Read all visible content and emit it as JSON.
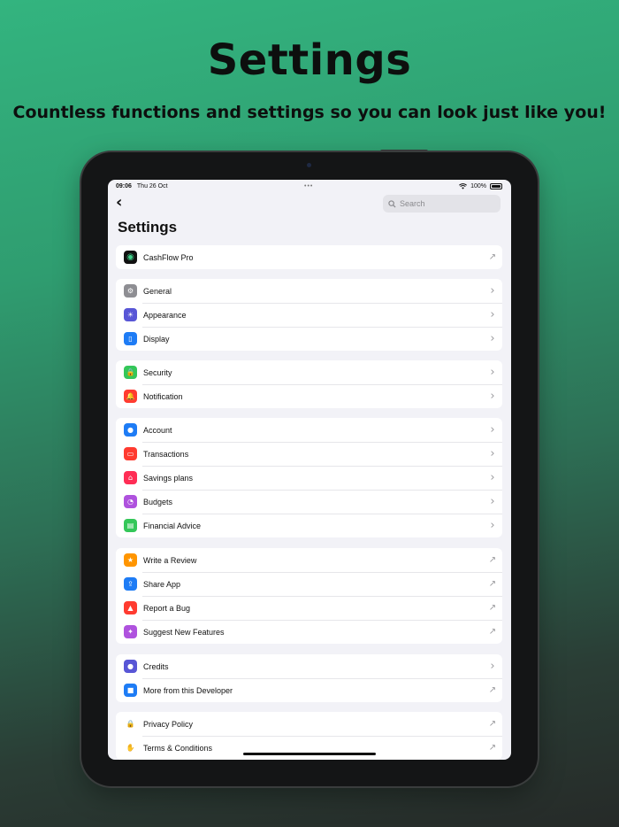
{
  "hero": {
    "title": "Settings",
    "subtitle": "Countless functions and settings so you can look just like you!"
  },
  "status_bar": {
    "time": "09:06",
    "date": "Thu 26 Oct",
    "battery": "100%"
  },
  "search": {
    "placeholder": "Search"
  },
  "page_title": "Settings",
  "groups": [
    [
      {
        "label": "CashFlow Pro",
        "icon": "app-logo-icon",
        "color": "#111111",
        "accessory": "external"
      }
    ],
    [
      {
        "label": "General",
        "icon": "gear-icon",
        "color": "#8e8e93",
        "accessory": "chevron"
      },
      {
        "label": "Appearance",
        "icon": "sun-icon",
        "color": "#5856d6",
        "accessory": "chevron"
      },
      {
        "label": "Display",
        "icon": "phone-icon",
        "color": "#1e7cf5",
        "accessory": "chevron"
      }
    ],
    [
      {
        "label": "Security",
        "icon": "lock-icon",
        "color": "#34c759",
        "accessory": "chevron"
      },
      {
        "label": "Notification",
        "icon": "bell-icon",
        "color": "#ff3b30",
        "accessory": "chevron"
      }
    ],
    [
      {
        "label": "Account",
        "icon": "person-icon",
        "color": "#1e7cf5",
        "accessory": "chevron"
      },
      {
        "label": "Transactions",
        "icon": "card-icon",
        "color": "#ff3b30",
        "accessory": "chevron"
      },
      {
        "label": "Savings plans",
        "icon": "bank-icon",
        "color": "#ff2d55",
        "accessory": "chevron"
      },
      {
        "label": "Budgets",
        "icon": "pie-chart-icon",
        "color": "#af52de",
        "accessory": "chevron"
      },
      {
        "label": "Financial Advice",
        "icon": "book-icon",
        "color": "#34c759",
        "accessory": "chevron"
      }
    ],
    [
      {
        "label": "Write a Review",
        "icon": "star-icon",
        "color": "#ff9500",
        "accessory": "external"
      },
      {
        "label": "Share App",
        "icon": "share-icon",
        "color": "#1e7cf5",
        "accessory": "external"
      },
      {
        "label": "Report a Bug",
        "icon": "warning-icon",
        "color": "#ff3b30",
        "accessory": "external"
      },
      {
        "label": "Suggest New Features",
        "icon": "sparkles-icon",
        "color": "#af52de",
        "accessory": "external"
      }
    ],
    [
      {
        "label": "Credits",
        "icon": "people-icon",
        "color": "#5856d6",
        "accessory": "chevron"
      },
      {
        "label": "More from this Developer",
        "icon": "apps-icon",
        "color": "#1e7cf5",
        "accessory": "external"
      }
    ],
    [
      {
        "label": "Privacy Policy",
        "icon": "lock-small-icon",
        "color": "plain",
        "accessory": "external"
      },
      {
        "label": "Terms & Conditions",
        "icon": "hand-icon",
        "color": "plain",
        "accessory": "external"
      }
    ]
  ]
}
